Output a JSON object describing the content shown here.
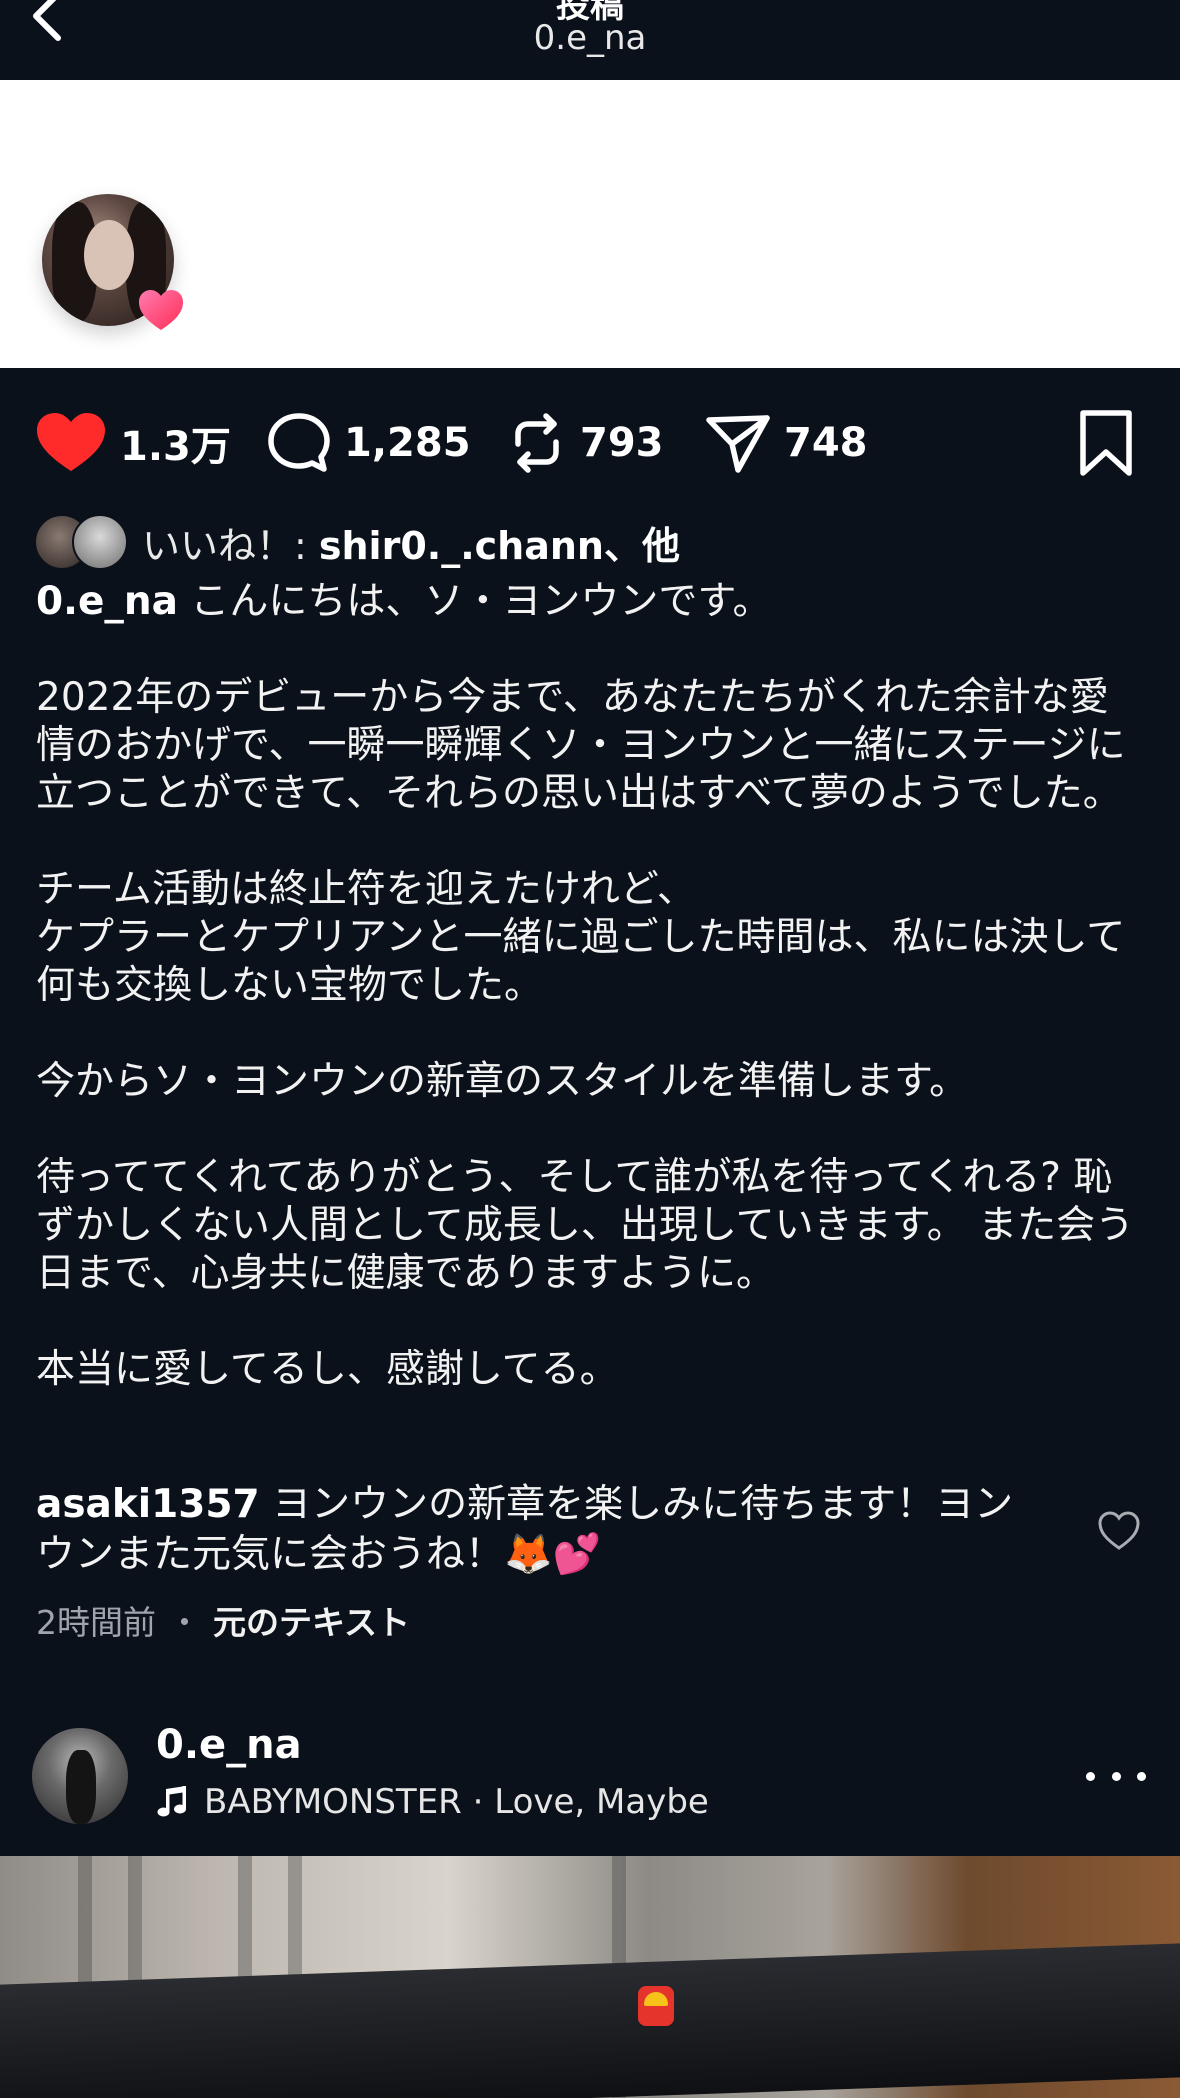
{
  "header": {
    "title": "投稿",
    "subtitle": "0.e_na"
  },
  "actions": {
    "likes": "1.3万",
    "comments": "1,285",
    "reposts": "793",
    "shares": "748"
  },
  "likes_row": {
    "prefix": "いいね！: ",
    "user": "shir0._.chann",
    "suffix": "、他"
  },
  "caption": {
    "username": "0.e_na",
    "text": " こんにちは、ソ・ヨンウンです。\n\n2022年のデビューから今まで、あなたたちがくれた余計な愛情のおかげで、一瞬一瞬輝くソ・ヨンウンと一緒にステージに立つことができて、それらの思い出はすべて夢のようでした。\n\nチーム活動は終止符を迎えたけれど、\nケプラーとケプリアンと一緒に過ごした時間は、私には決して何も交換しない宝物でした。\n\n今からソ・ヨンウンの新章のスタイルを準備します。\n\n待っててくれてありがとう、そして誰が私を待ってくれる? 恥ずかしくない人間として成長し、出現していきます。 また会う日まで、心身共に健康でありますように。\n\n本当に愛してるし、感謝してる。"
  },
  "comment": {
    "username": "asaki1357",
    "text": " ヨンウンの新章を楽しみに待ちます！ヨンウンまた元気に会おうね！🦊💕"
  },
  "meta": {
    "time": "2時間前",
    "separator": "・",
    "translate": "元のテキスト"
  },
  "next_post": {
    "username": "0.e_na",
    "music": "BABYMONSTER · Love, Maybe"
  },
  "colors": {
    "background": "#0b111a",
    "like_red": "#ff2b2b",
    "text": "#ffffff"
  },
  "icons": [
    "back-icon",
    "heart-icon",
    "comment-icon",
    "repost-icon",
    "share-icon",
    "bookmark-icon",
    "music-note-icon",
    "more-icon"
  ]
}
